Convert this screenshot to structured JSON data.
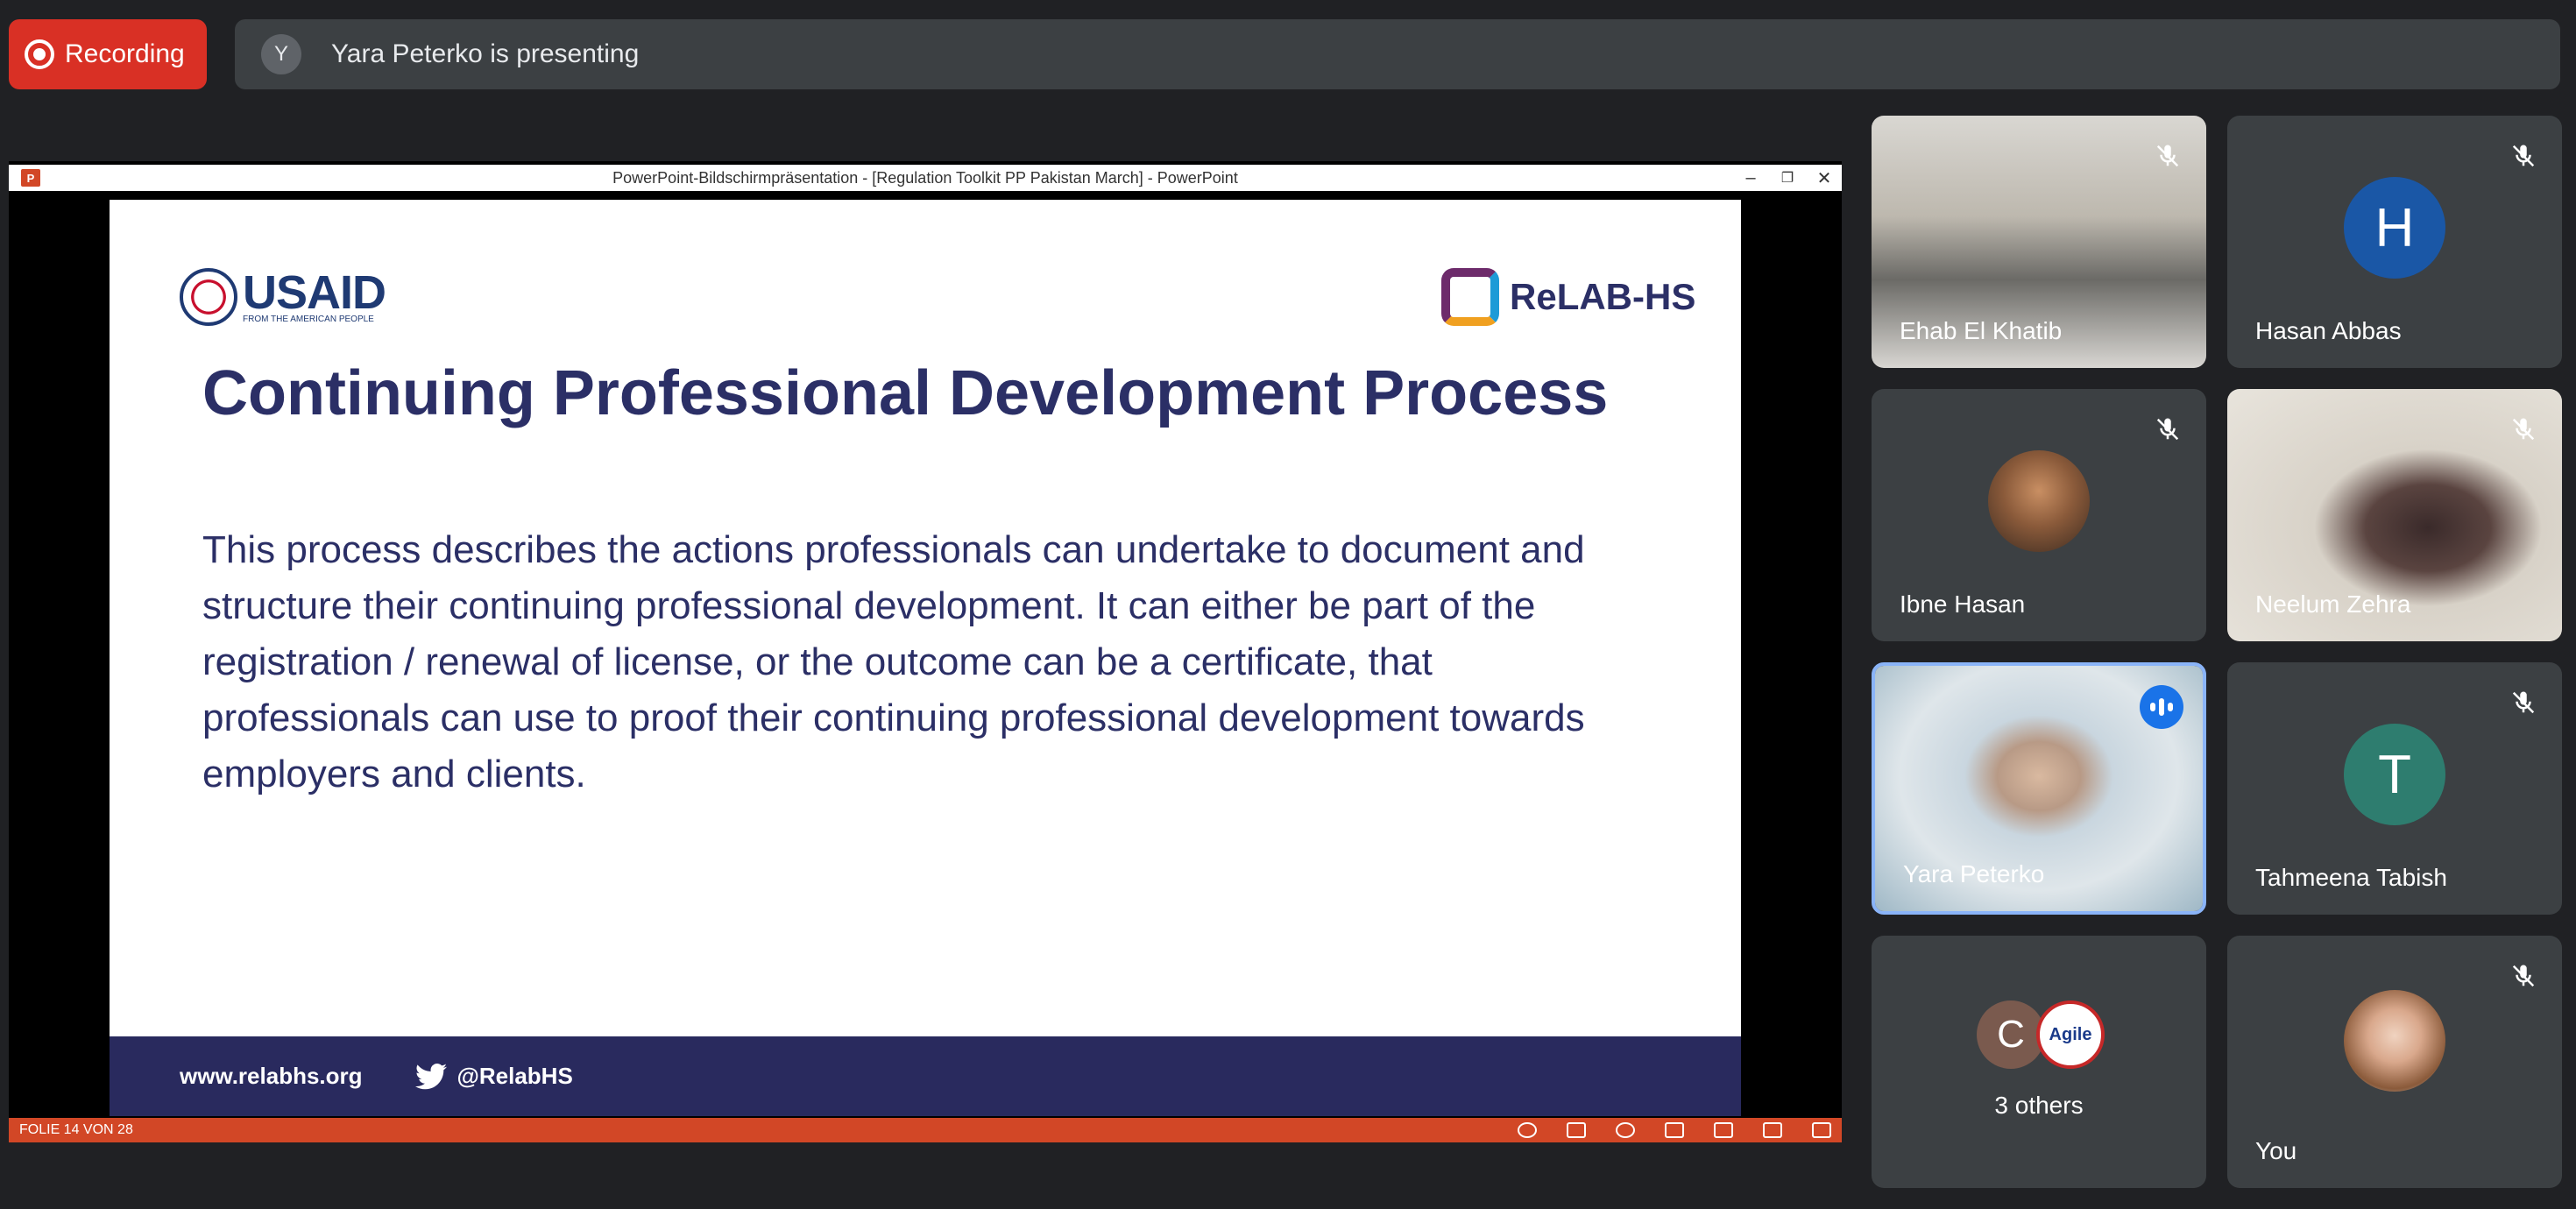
{
  "topbar": {
    "recording_label": "Recording",
    "presenter_initial": "Y",
    "presenting_text": "Yara Peterko is presenting"
  },
  "presentation": {
    "window_title": "PowerPoint-Bildschirmpräsentation - [Regulation Toolkit PP Pakistan March] - PowerPoint",
    "slide": {
      "logo_left_text": "USAID",
      "logo_left_subtext": "FROM THE AMERICAN PEOPLE",
      "logo_right_text": "ReLAB-HS",
      "title": "Continuing Professional Development Process",
      "body": "This process describes the actions professionals can undertake to document and structure their continuing professional development. It can either be part of the registration / renewal of license, or the outcome can be a certificate, that professionals can use to proof their continuing professional development towards employers and clients.",
      "footer_url": "www.relabhs.org",
      "footer_twitter": "@RelabHS"
    },
    "status_text": "FOLIE 14 VON 28"
  },
  "participants": [
    {
      "name": "Ehab El Khatib",
      "muted": true
    },
    {
      "name": "Hasan Abbas",
      "initial": "H",
      "color": "#1a57a6",
      "muted": true
    },
    {
      "name": "Ibne Hasan",
      "muted": true
    },
    {
      "name": "Neelum Zehra",
      "muted": true
    },
    {
      "name": "Yara Peterko",
      "speaking": true
    },
    {
      "name": "Tahmeena Tabish",
      "initial": "T",
      "color": "#2e7d6f",
      "muted": true
    },
    {
      "name": "3 others",
      "avatar_initial": "C",
      "avatar_logo_text": "Agile"
    },
    {
      "name": "You",
      "muted": true
    }
  ]
}
